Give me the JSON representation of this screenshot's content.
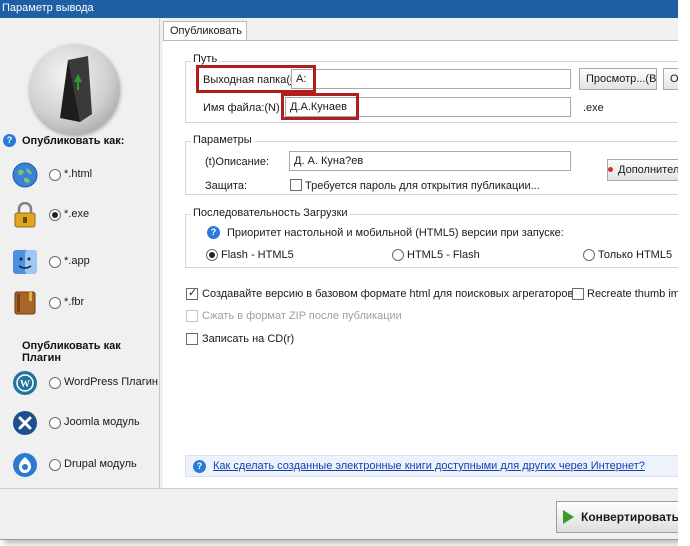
{
  "window": {
    "title": "Параметр вывода"
  },
  "sidebar": {
    "publish_as": "Опубликовать как:",
    "formats": [
      {
        "label": "*.html",
        "icon": "globe-icon",
        "selected": false
      },
      {
        "label": "*.exe",
        "icon": "lock-icon",
        "selected": true
      },
      {
        "label": "*.app",
        "icon": "mac-finder-icon",
        "selected": false
      },
      {
        "label": "*.fbr",
        "icon": "book-icon",
        "selected": false
      }
    ],
    "publish_as_plugin": "Опубликовать как Плагин",
    "plugins": [
      {
        "label": "WordPress Плагин",
        "icon": "wordpress-icon"
      },
      {
        "label": "Joomla модуль",
        "icon": "joomla-icon"
      },
      {
        "label": "Drupal модуль",
        "icon": "drupal-icon"
      }
    ]
  },
  "tabs": {
    "publish": "Опубликовать"
  },
  "path_group": {
    "title": "Путь",
    "output_folder_label": "Выходная папка(",
    "output_folder_mnemonic": "u",
    "output_folder_value": "A:",
    "browse_button": "Просмотр...(B)",
    "open_button": "Открыть",
    "file_name_label": "Имя файла:(N)",
    "file_name_value": "Д.А.Кунаев",
    "extension": ".exe"
  },
  "params_group": {
    "title": "Параметры",
    "description_label": "(t)Описание:",
    "description_value": "Д. А. Куна?ев",
    "protection_label": "Защита:",
    "password_label": "Требуется пароль для открытия публикации...",
    "password_checked": false,
    "advanced_button": "Дополнительно"
  },
  "load_group": {
    "title": "Последовательность Загрузки",
    "priority_text": "Приоритет настольной и мобильной (HTML5) версии при запуске:",
    "options": [
      {
        "label": "Flash - HTML5",
        "selected": true
      },
      {
        "label": "HTML5 - Flash",
        "selected": false
      },
      {
        "label": "Только HTML5",
        "selected": false
      }
    ]
  },
  "options": {
    "basic_html": {
      "label": "Создавайте версию в базовом формате html для поисковых агрегаторов",
      "checked": true
    },
    "recreate_thumb": {
      "label": "Recreate thumb image",
      "checked": false
    },
    "zip": {
      "label": "Сжать в формат ZIP после публикации",
      "checked": false,
      "disabled": true
    },
    "cd": {
      "label": "Записать на CD(r)",
      "checked": false
    }
  },
  "help_link": "Как сделать созданные электронные книги доступными для других через Интернет?",
  "convert_button": "Конвертировать"
}
